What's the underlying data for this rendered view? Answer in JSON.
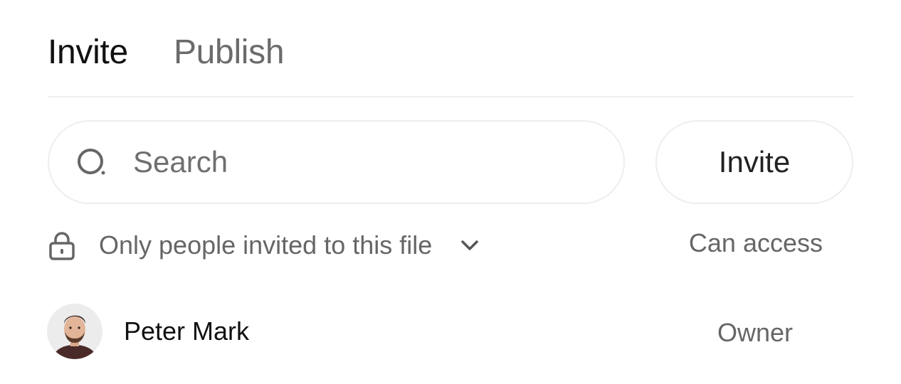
{
  "tabs": [
    {
      "label": "Invite",
      "active": true
    },
    {
      "label": "Publish",
      "active": false
    }
  ],
  "search": {
    "placeholder": "Search",
    "value": "",
    "icon": "search-icon"
  },
  "invite_button": {
    "label": "Invite"
  },
  "access": {
    "icon": "lock-icon",
    "label": "Only people invited to this file",
    "dropdown_icon": "chevron-down-icon",
    "permission_label": "Can access"
  },
  "members": [
    {
      "name": "Peter Mark",
      "role": "Owner"
    }
  ],
  "colors": {
    "active_text": "#111111",
    "muted_text": "#666666",
    "border": "#eeeeee"
  }
}
